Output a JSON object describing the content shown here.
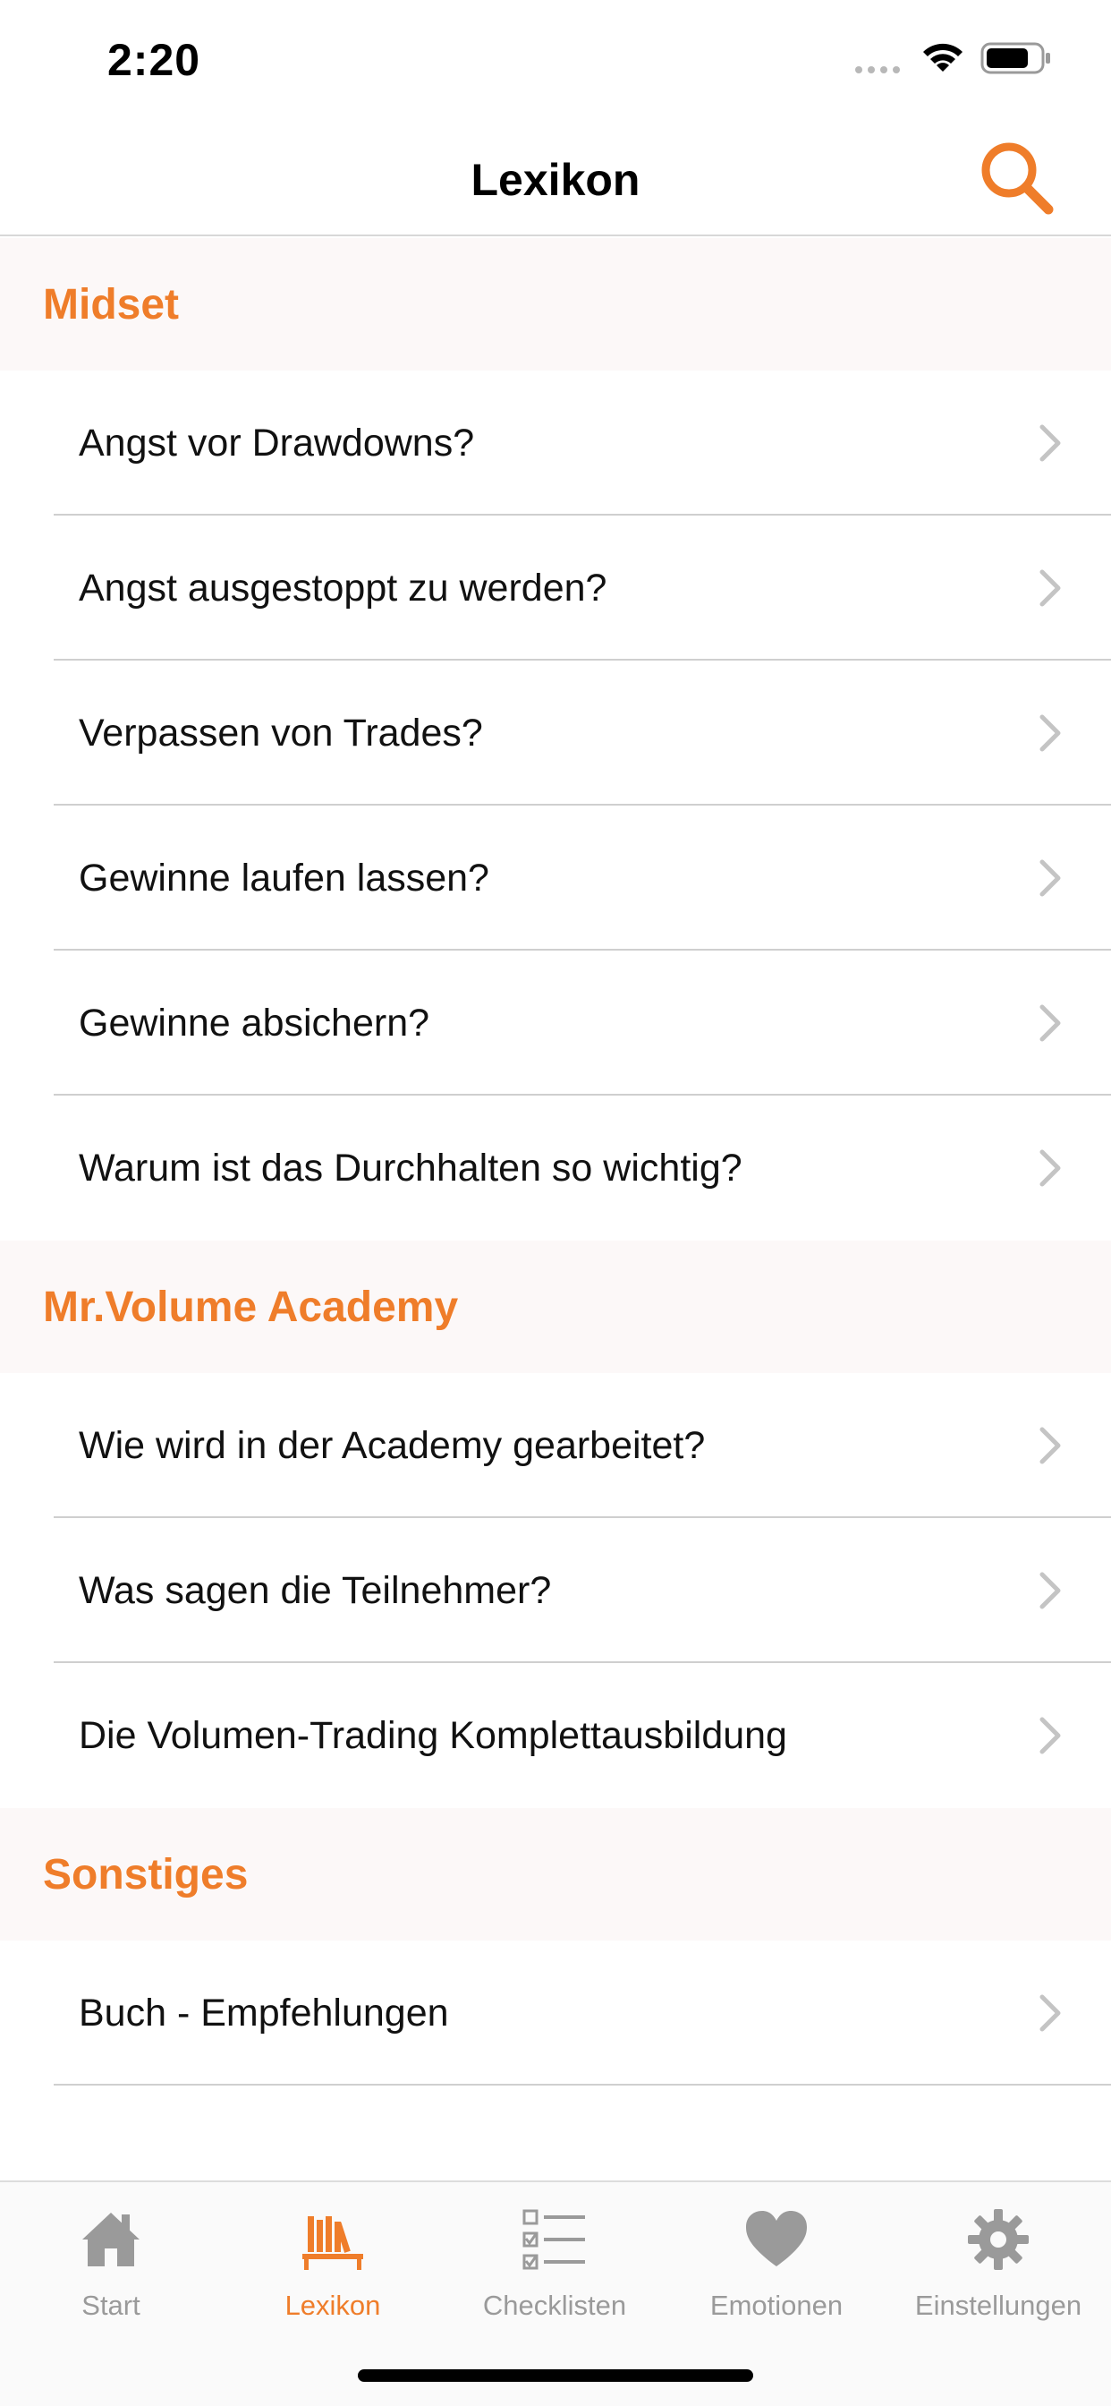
{
  "status_bar": {
    "time": "2:20"
  },
  "nav": {
    "title": "Lexikon",
    "search_icon": "search-icon"
  },
  "colors": {
    "accent": "#ef7d2a",
    "section_bg": "#fcf8f8",
    "inactive_tab": "#9a9a9a"
  },
  "sections": [
    {
      "title": "Midset",
      "items": [
        "Angst vor Drawdowns?",
        "Angst ausgestoppt zu werden?",
        "Verpassen von Trades?",
        "Gewinne laufen lassen?",
        "Gewinne absichern?",
        "Warum ist das Durchhalten so wichtig?"
      ]
    },
    {
      "title": "Mr.Volume Academy",
      "items": [
        "Wie wird in der Academy gearbeitet?",
        "Was sagen die Teilnehmer?",
        "Die Volumen-Trading Komplettausbildung"
      ]
    },
    {
      "title": "Sonstiges",
      "items": [
        "Buch - Empfehlungen"
      ]
    }
  ],
  "tabs": [
    {
      "label": "Start",
      "icon": "home-icon",
      "active": false
    },
    {
      "label": "Lexikon",
      "icon": "books-icon",
      "active": true
    },
    {
      "label": "Checklisten",
      "icon": "checklist-icon",
      "active": false
    },
    {
      "label": "Emotionen",
      "icon": "heart-icon",
      "active": false
    },
    {
      "label": "Einstellungen",
      "icon": "gear-icon",
      "active": false
    }
  ]
}
